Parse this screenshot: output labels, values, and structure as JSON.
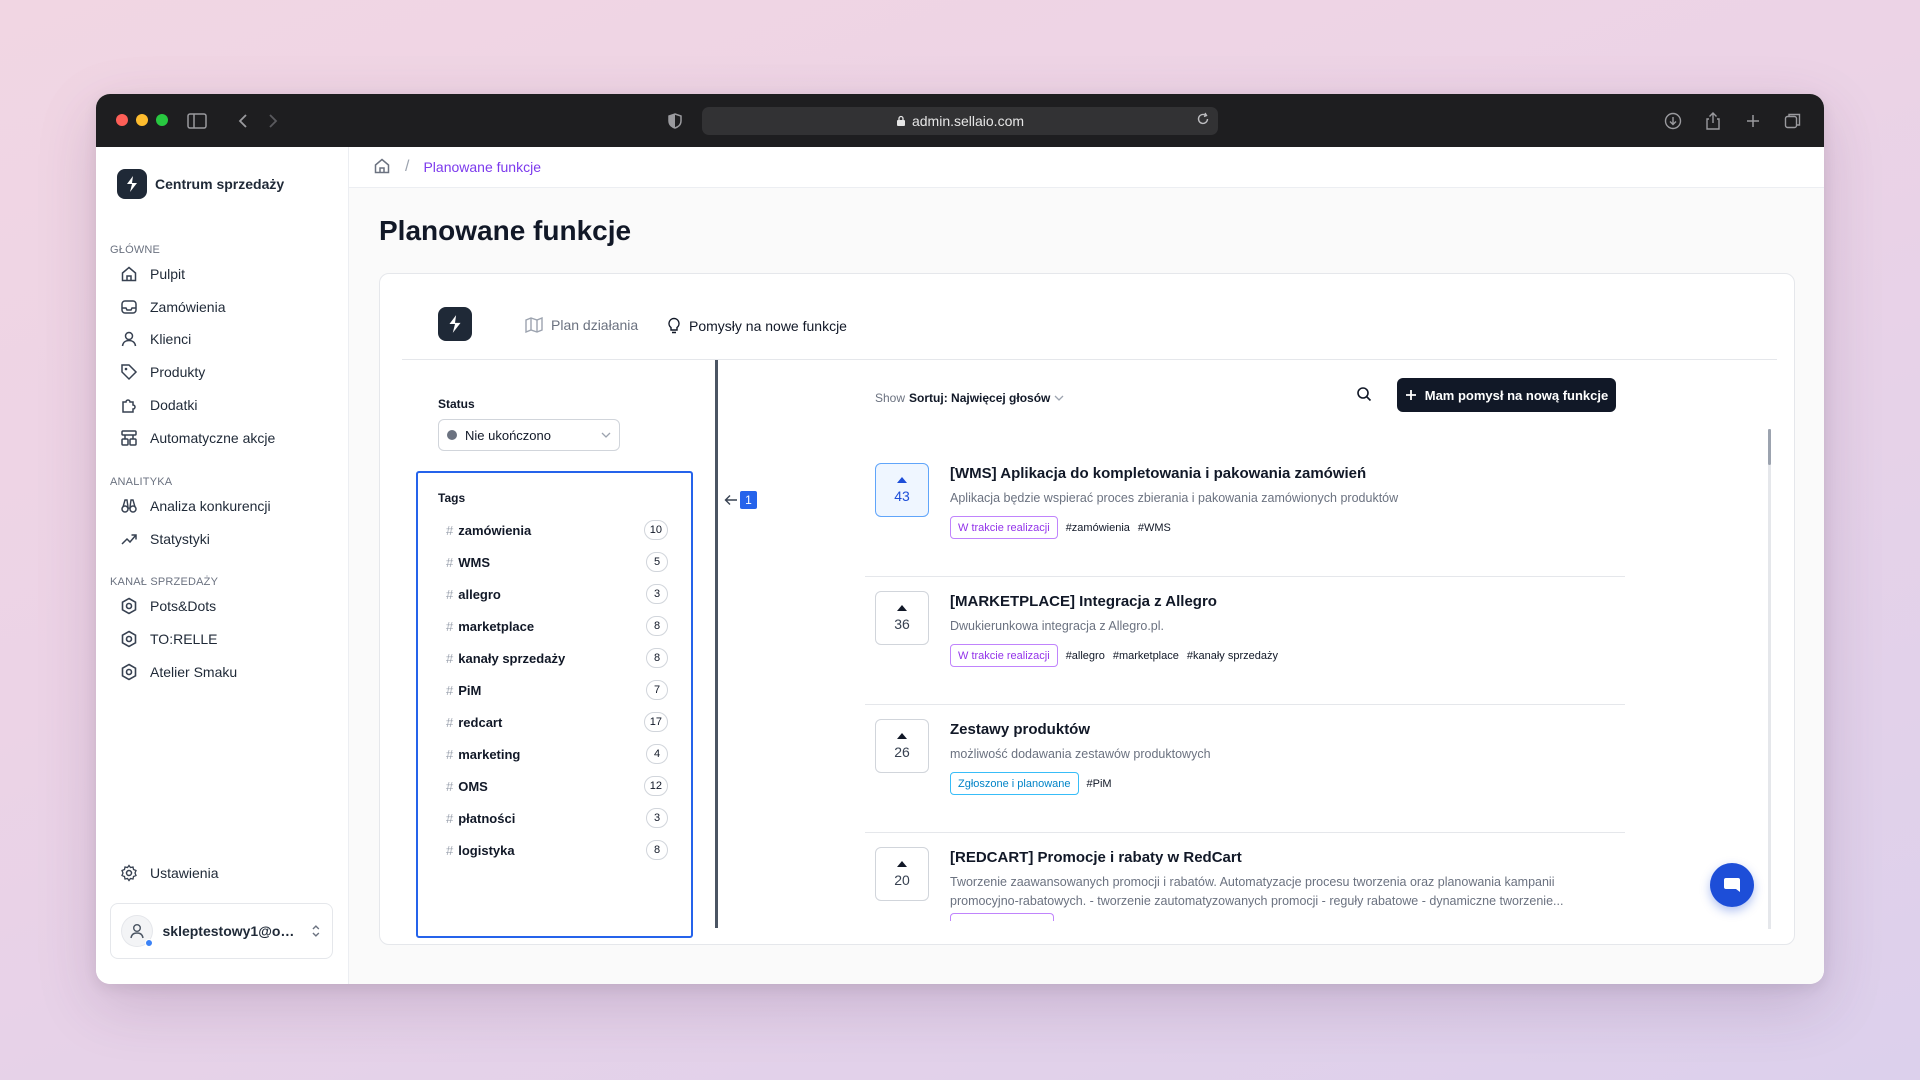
{
  "browser": {
    "url": "admin.sellaio.com"
  },
  "sidebar": {
    "brand": "Centrum sprzedaży",
    "sections": [
      {
        "label": "GŁÓWNE",
        "items": [
          {
            "label": "Pulpit",
            "icon": "home-icon"
          },
          {
            "label": "Zamówienia",
            "icon": "inbox-icon"
          },
          {
            "label": "Klienci",
            "icon": "user-icon"
          },
          {
            "label": "Produkty",
            "icon": "tag-icon"
          },
          {
            "label": "Dodatki",
            "icon": "puzzle-icon"
          },
          {
            "label": "Automatyczne akcje",
            "icon": "workflow-icon"
          }
        ]
      },
      {
        "label": "ANALITYKA",
        "items": [
          {
            "label": "Analiza konkurencji",
            "icon": "binoculars-icon"
          },
          {
            "label": "Statystyki",
            "icon": "trending-up-icon"
          }
        ]
      },
      {
        "label": "KANAŁ SPRZEDAŻY",
        "items": [
          {
            "label": "Pots&Dots",
            "icon": "channel-icon"
          },
          {
            "label": "TO:RELLE",
            "icon": "channel-icon"
          },
          {
            "label": "Atelier Smaku",
            "icon": "channel-icon"
          }
        ]
      }
    ],
    "settings": "Ustawienia",
    "user_email": "skleptestowy1@onet..."
  },
  "breadcrumb": {
    "current": "Planowane funkcje"
  },
  "page": {
    "title": "Planowane funkcje"
  },
  "tabs": {
    "roadmap": "Plan działania",
    "ideas": "Pomysły na nowe funkcje"
  },
  "filters": {
    "status_label": "Status",
    "status_value": "Nie ukończono",
    "tags_title": "Tags",
    "tags": [
      {
        "name": "zamówienia",
        "count": "10"
      },
      {
        "name": "WMS",
        "count": "5"
      },
      {
        "name": "allegro",
        "count": "3"
      },
      {
        "name": "marketplace",
        "count": "8"
      },
      {
        "name": "kanały sprzedaży",
        "count": "8"
      },
      {
        "name": "PiM",
        "count": "7"
      },
      {
        "name": "redcart",
        "count": "17"
      },
      {
        "name": "marketing",
        "count": "4"
      },
      {
        "name": "OMS",
        "count": "12"
      },
      {
        "name": "płatności",
        "count": "3"
      },
      {
        "name": "logistyka",
        "count": "8"
      }
    ],
    "annotation_number": "1"
  },
  "toolbar": {
    "show_label": "Show",
    "sort_label": "Sortuj: Najwięcej głosów",
    "new_idea_button": "Mam pomysł na nową funkcje"
  },
  "features": [
    {
      "votes": "43",
      "title": "[WMS] Aplikacja do kompletowania i pakowania zamówień",
      "desc": "Aplikacja będzie wspierać proces zbierania i pakowania zamówionych produktów",
      "status": "W trakcie realizacji",
      "tags": [
        "#zamówienia",
        "#WMS"
      ]
    },
    {
      "votes": "36",
      "title": "[MARKETPLACE] Integracja z Allegro",
      "desc": "Dwukierunkowa integracja z Allegro.pl.",
      "status": "W trakcie realizacji",
      "tags": [
        "#allegro",
        "#marketplace",
        "#kanały sprzedaży"
      ]
    },
    {
      "votes": "26",
      "title": "Zestawy produktów",
      "desc": "możliwość dodawania zestawów produktowych",
      "status": "Zgłoszone i planowane",
      "tags": [
        "#PiM"
      ]
    },
    {
      "votes": "20",
      "title": "[REDCART] Promocje i rabaty w RedCart",
      "desc": "Tworzenie zaawansowanych promocji i rabatów. Automatyzacje procesu tworzenia oraz planowania kampanii promocyjno-rabatowych. - tworzenie zautomatyzowanych promocji - reguły rabatowe - dynamiczne tworzenie...",
      "status": "",
      "tags": []
    }
  ],
  "colors": {
    "accent": "#7c3aed",
    "primary_button": "#111827",
    "selection": "#2563eb",
    "chat": "#1d4ed8"
  }
}
